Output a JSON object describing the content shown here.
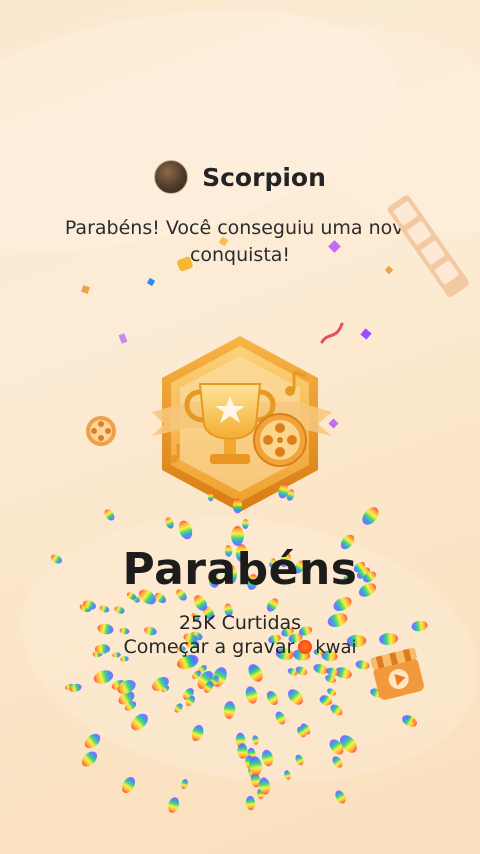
{
  "profile": {
    "username": "Scorpion"
  },
  "message": {
    "subtitle": "Parabéns! Você conseguiu uma nova conquista!"
  },
  "achievement": {
    "title": "Parabéns",
    "count_text": "25K Curtidas",
    "record_text": "Começar a gravar",
    "brand": "kwai"
  },
  "colors": {
    "badge_gold": "#f5b43a",
    "badge_edge": "#e68a1d",
    "accent_orange": "#ff6a1a",
    "background": "#fbe8cf"
  },
  "icons": {
    "badge": "trophy-icon",
    "film_reel": "film-reel-icon",
    "music_note": "music-note-icon",
    "play": "play-icon"
  }
}
